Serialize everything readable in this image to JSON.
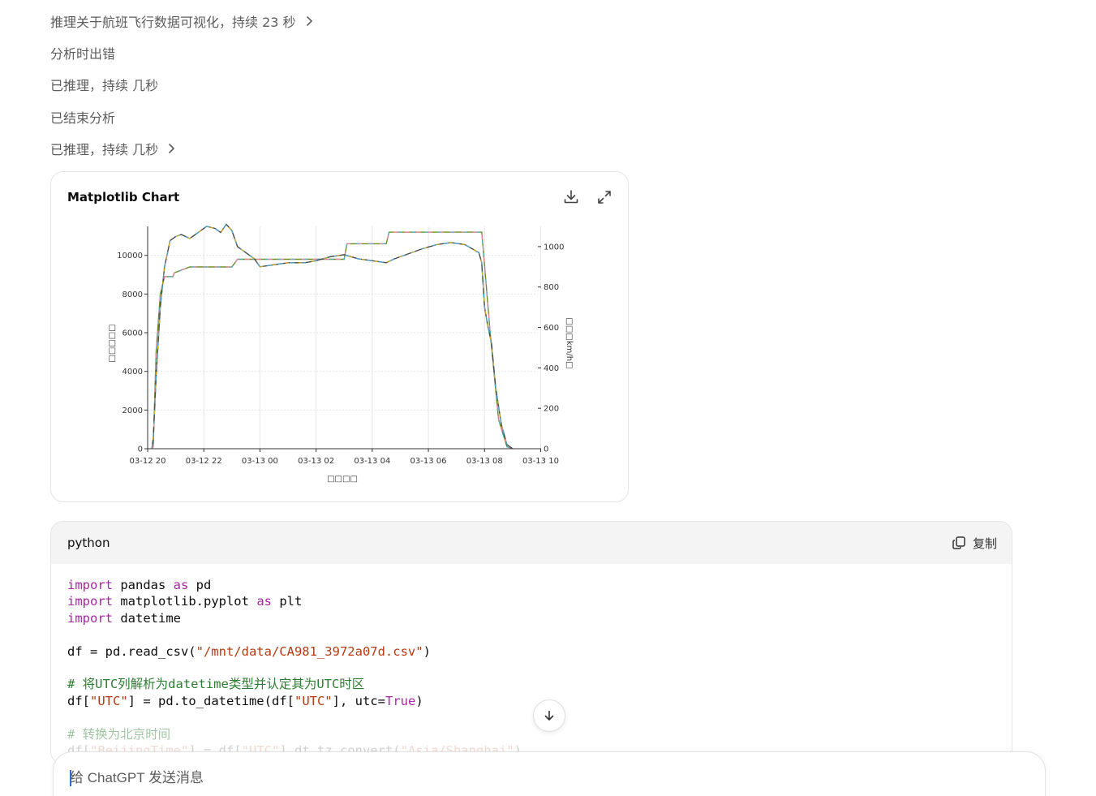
{
  "status_lines": [
    {
      "text": "推理关于航班飞行数据可视化，持续 23 秒",
      "chevron": true
    },
    {
      "text": "分析时出错",
      "chevron": false
    },
    {
      "text": "已推理，持续 几秒",
      "chevron": false
    },
    {
      "text": "已结束分析",
      "chevron": false
    },
    {
      "text": "已推理，持续 几秒",
      "chevron": true
    }
  ],
  "chart_card": {
    "title": "Matplotlib Chart",
    "download_icon": "download-icon",
    "expand_icon": "expand-icon"
  },
  "chart_data": {
    "type": "line",
    "title": "",
    "xlabel": "□□□□",
    "ylabel_left": "□□□□□",
    "ylabel_right": "□□□km/h□",
    "x_ticks": [
      "03-12 20",
      "03-12 22",
      "03-13 00",
      "03-13 02",
      "03-13 04",
      "03-13 06",
      "03-13 08",
      "03-13 10"
    ],
    "y_left_ticks": [
      "0",
      "2000",
      "4000",
      "6000",
      "8000",
      "10000"
    ],
    "y_right_ticks": [
      "0",
      "200",
      "400",
      "600",
      "800",
      "1000"
    ],
    "ylim_left": [
      0,
      11500
    ],
    "ylim_right": [
      0,
      1100
    ],
    "grid": true,
    "series": [
      {
        "axis": "left",
        "color": "#6b8e23",
        "points": [
          [
            0.15,
            0
          ],
          [
            0.2,
            100
          ],
          [
            0.3,
            5000
          ],
          [
            0.45,
            8000
          ],
          [
            0.6,
            8900
          ],
          [
            0.9,
            8900
          ],
          [
            0.95,
            9100
          ],
          [
            1.5,
            9400
          ],
          [
            3.0,
            9400
          ],
          [
            3.2,
            9800
          ],
          [
            7.0,
            9800
          ],
          [
            7.1,
            10600
          ],
          [
            8.5,
            10600
          ],
          [
            8.6,
            11200
          ],
          [
            11.0,
            11200
          ],
          [
            11.9,
            11200
          ],
          [
            12.0,
            9500
          ],
          [
            12.2,
            6000
          ],
          [
            12.5,
            1500
          ],
          [
            12.8,
            100
          ],
          [
            13.0,
            0
          ]
        ]
      },
      {
        "axis": "right",
        "color": "#4a4a4a",
        "points": [
          [
            0.15,
            0
          ],
          [
            0.2,
            50
          ],
          [
            0.3,
            350
          ],
          [
            0.45,
            700
          ],
          [
            0.6,
            900
          ],
          [
            0.8,
            1030
          ],
          [
            1.0,
            1050
          ],
          [
            1.2,
            1060
          ],
          [
            1.5,
            1040
          ],
          [
            1.8,
            1070
          ],
          [
            2.1,
            1100
          ],
          [
            2.4,
            1090
          ],
          [
            2.6,
            1070
          ],
          [
            2.8,
            1110
          ],
          [
            3.0,
            1080
          ],
          [
            3.2,
            1000
          ],
          [
            3.4,
            980
          ],
          [
            3.6,
            960
          ],
          [
            3.8,
            940
          ],
          [
            4.0,
            900
          ],
          [
            4.5,
            910
          ],
          [
            5.0,
            920
          ],
          [
            5.6,
            920
          ],
          [
            6.0,
            930
          ],
          [
            6.5,
            950
          ],
          [
            7.0,
            960
          ],
          [
            7.5,
            940
          ],
          [
            8.0,
            930
          ],
          [
            8.5,
            920
          ],
          [
            8.8,
            940
          ],
          [
            9.2,
            960
          ],
          [
            9.8,
            990
          ],
          [
            10.3,
            1010
          ],
          [
            10.8,
            1020
          ],
          [
            11.3,
            1010
          ],
          [
            11.8,
            970
          ],
          [
            11.9,
            920
          ],
          [
            12.0,
            700
          ],
          [
            12.1,
            620
          ],
          [
            12.25,
            520
          ],
          [
            12.4,
            300
          ],
          [
            12.6,
            120
          ],
          [
            12.8,
            20
          ],
          [
            13.0,
            0
          ]
        ]
      }
    ]
  },
  "code_block": {
    "language": "python",
    "copy_label": "复制",
    "lines": [
      "import pandas as pd",
      "import matplotlib.pyplot as plt",
      "import datetime",
      "",
      "df = pd.read_csv(\"/mnt/data/CA981_3972a07d.csv\")",
      "",
      "# 将UTC列解析为datetime类型并认定其为UTC时区",
      "df[\"UTC\"] = pd.to_datetime(df[\"UTC\"], utc=True)",
      "",
      "# 转换为北京时间",
      "df[\"BeijingTime\"] = df[\"UTC\"].dt.tz_convert(\"Asia/Shanghai\")"
    ]
  },
  "composer": {
    "placeholder": "给 ChatGPT 发送消息"
  }
}
